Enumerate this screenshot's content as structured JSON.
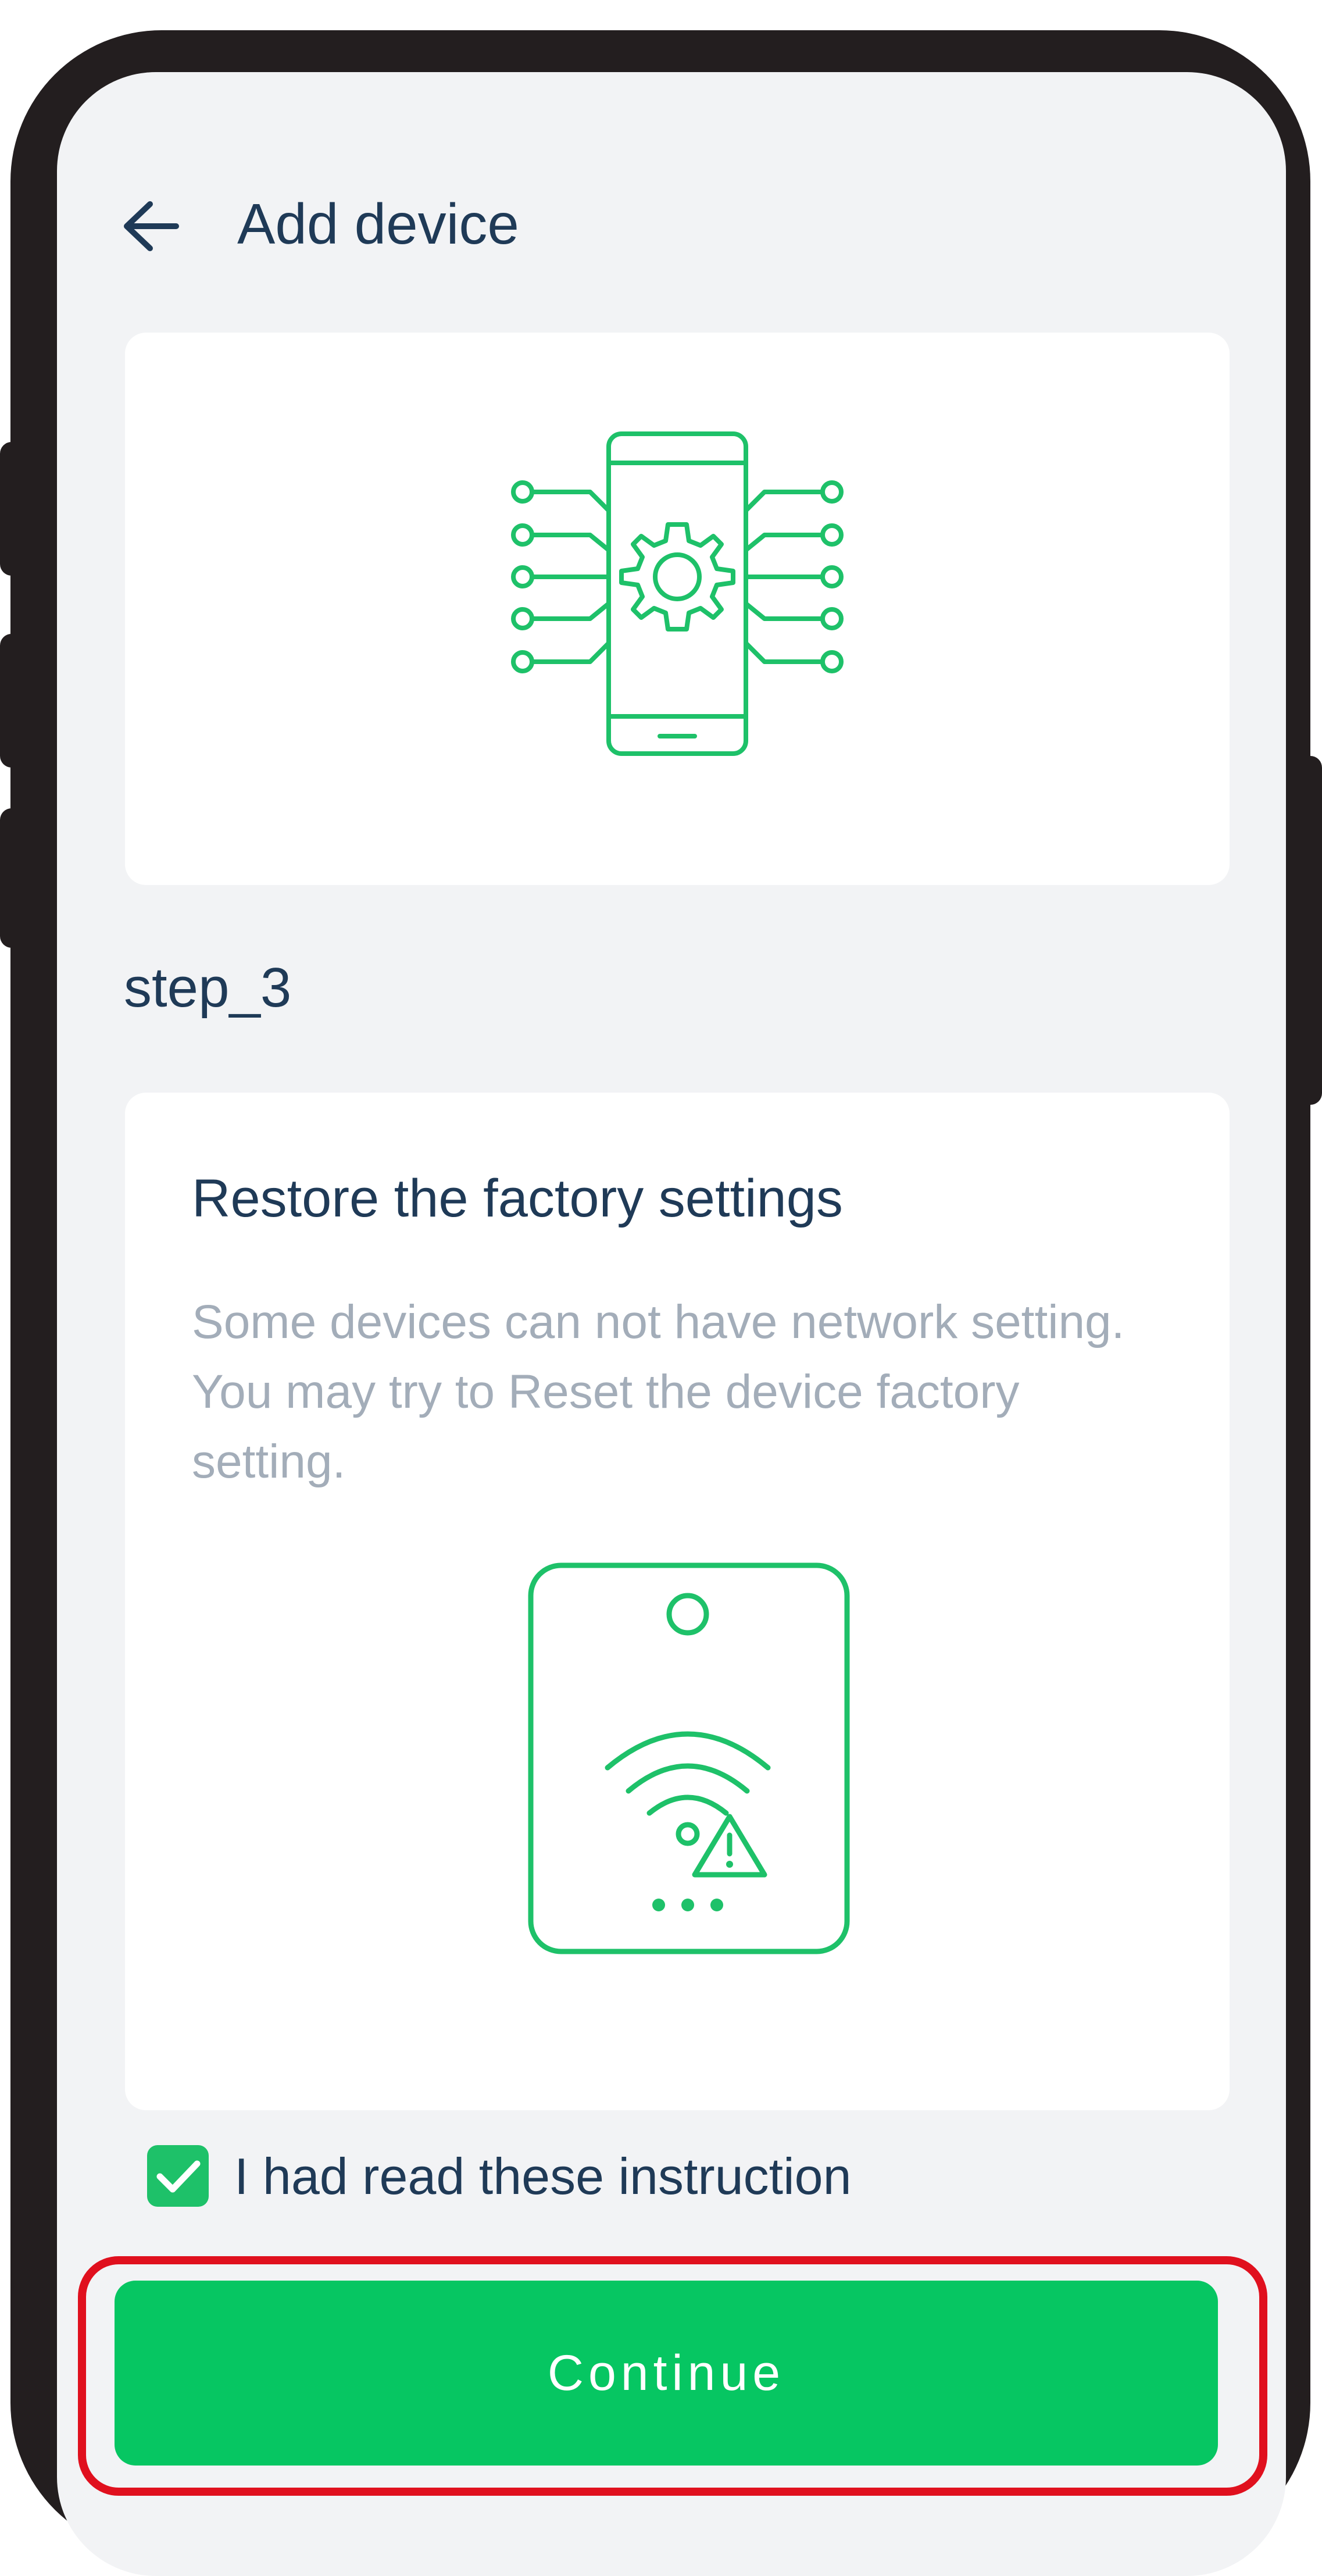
{
  "header": {
    "title": "Add device"
  },
  "step": {
    "label": "step_3"
  },
  "instruction": {
    "title": "Restore the factory settings",
    "description": "Some devices can not have network setting. You may try to Reset the device factory setting."
  },
  "confirm": {
    "label": "I had read these instruction",
    "checked": true
  },
  "footer": {
    "continue_label": "Continue"
  },
  "colors": {
    "accent": "#06c662",
    "icon_green": "#1ec169",
    "title_text": "#1f3a57",
    "muted_text": "#a3adb9",
    "highlight": "#e0101e"
  },
  "icons": [
    "arrow-left-icon",
    "phone-gear-circuit-icon",
    "router-wifi-warning-icon",
    "checkmark-icon"
  ]
}
